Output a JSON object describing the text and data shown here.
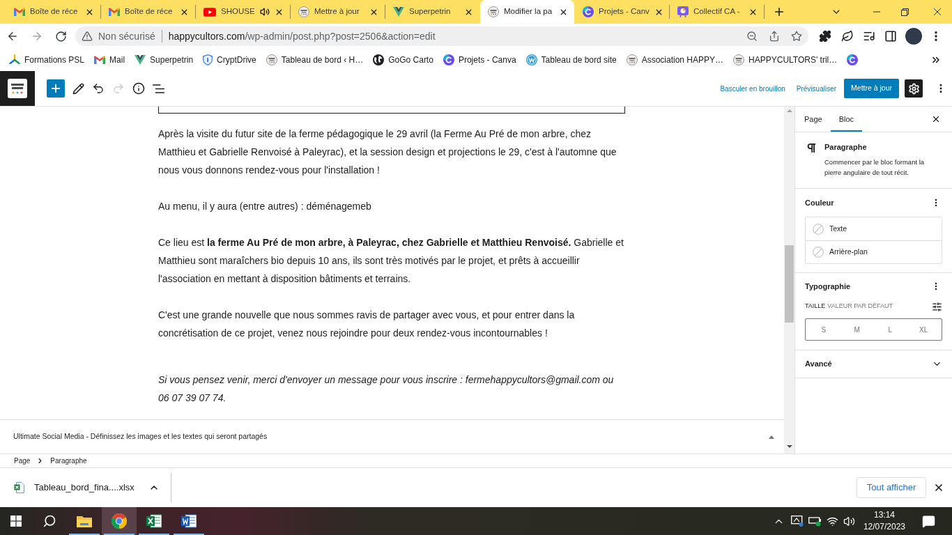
{
  "browser": {
    "tabs": [
      {
        "title": "Boîte de réce",
        "kind": "mail",
        "audio": false,
        "selected": false
      },
      {
        "title": "Boîte de réce",
        "kind": "mail",
        "audio": false,
        "selected": false
      },
      {
        "title": "SHOUSE",
        "kind": "video",
        "audio": true,
        "selected": false
      },
      {
        "title": "Mettre à jour",
        "kind": "site",
        "audio": false,
        "selected": false
      },
      {
        "title": "Superpetrin",
        "kind": "vshape",
        "audio": false,
        "selected": false
      },
      {
        "title": "Modifier la pa",
        "kind": "site",
        "audio": false,
        "selected": true
      },
      {
        "title": "Projets - Canv",
        "kind": "canva",
        "audio": false,
        "selected": false
      },
      {
        "title": "Collectif CA -",
        "kind": "presentation",
        "audio": false,
        "selected": false
      }
    ],
    "address": {
      "security": "Non sécurisé",
      "host": "happycultors.com",
      "path": "/wp-admin/post.php?post=2506&action=edit"
    },
    "bookmarks": [
      {
        "label": "Formations PSL",
        "kind": "triad"
      },
      {
        "label": "Mail",
        "kind": "mail"
      },
      {
        "label": "Superpetrin",
        "kind": "vshape"
      },
      {
        "label": "CryptDrive",
        "kind": "shield"
      },
      {
        "label": "Tableau de bord ‹ H…",
        "kind": "site"
      },
      {
        "label": "GoGo Carto",
        "kind": "globe"
      },
      {
        "label": "Projets - Canva",
        "kind": "canva"
      },
      {
        "label": "Tableau de bord site",
        "kind": "wordpress"
      },
      {
        "label": "Association HAPPY…",
        "kind": "site"
      },
      {
        "label": "HAPPYCULTORS' tril…",
        "kind": "site"
      },
      {
        "kind": "canva"
      }
    ]
  },
  "editor": {
    "tools": [
      {
        "kind": "add"
      },
      {
        "kind": "edit"
      },
      {
        "kind": "undo",
        "disabled": false
      },
      {
        "kind": "redo",
        "disabled": true
      },
      {
        "kind": "info"
      },
      {
        "kind": "outline"
      }
    ],
    "draft_link": "Basculer en brouillon",
    "preview_link": "Prévisualiser",
    "update_button": "Mettre à jour",
    "settings_active": true,
    "paragraphs": [
      {
        "text": "Après la visite du futur site de la ferme pédagogique le 29 avril (la Ferme Au Pré de mon arbre, chez Matthieu et Gabrielle Renvoisé à Paleyrac), et la session design et projections le 29, c'est à l'automne que nous vous donnons rendez-vous pour l'installation !",
        "italic": false
      },
      {
        "text": "Au menu, il y aura (entre autres) : déménagemeb",
        "italic": false
      },
      {
        "text": "Ce lieu est **la ferme Au Pré de mon arbre, à Paleyrac, chez Gabrielle et Matthieu Renvoisé.** Gabrielle et Matthieu sont maraîchers bio depuis 10 ans, ils sont très motivés par le projet, et prêts à accueillir l'association en mettant à disposition bâtiments et terrains.",
        "italic": false
      },
      {
        "text": "C'est une grande nouvelle que nous sommes ravis de partager avec vous, et pour entrer dans la concrétisation de ce projet, venez nous rejoindre pour deux rendez-vous incontournables !",
        "italic": false
      },
      {
        "text": "Si vous pensez venir, merci d'envoyer un message pour vous inscrire : fermehappycultors@gmail.com ou 06 07 39 07 74.",
        "italic": true
      }
    ],
    "meta_box": {
      "title": "Ultimate Social Media - Définissez les images et les textes qui seront partagés"
    },
    "breadcrumb": [
      "Page",
      "Paragraphe"
    ]
  },
  "sidebar": {
    "tabs": [
      {
        "label": "Page",
        "selected": false
      },
      {
        "label": "Bloc",
        "selected": true
      }
    ],
    "block": {
      "name": "Paragraphe",
      "description": "Commencer par le bloc formant la pierre angulaire de tout récit."
    },
    "color": {
      "title": "Couleur",
      "items": [
        "Texte",
        "Arrière-plan"
      ]
    },
    "typography": {
      "title": "Typographie",
      "size_label": "TAILLE",
      "size_value": "VALEUR PAR DÉFAUT",
      "sizes": [
        {
          "label": "S",
          "selected": false
        },
        {
          "label": "M",
          "selected": false
        },
        {
          "label": "L",
          "selected": false
        },
        {
          "label": "XL",
          "selected": false
        }
      ]
    },
    "advanced": {
      "title": "Avancé",
      "expanded": false
    }
  },
  "downloads": {
    "file": "Tableau_bord_fina....xlsx",
    "show_all": "Tout afficher"
  },
  "taskbar": {
    "apps": [
      {
        "kind": "folder",
        "running": true,
        "selected": false
      },
      {
        "kind": "browser",
        "running": true,
        "selected": true
      },
      {
        "kind": "sheet",
        "running": true,
        "selected": false
      },
      {
        "kind": "doc",
        "running": true,
        "selected": false
      }
    ],
    "time": "13:14",
    "date": "12/07/2023"
  }
}
